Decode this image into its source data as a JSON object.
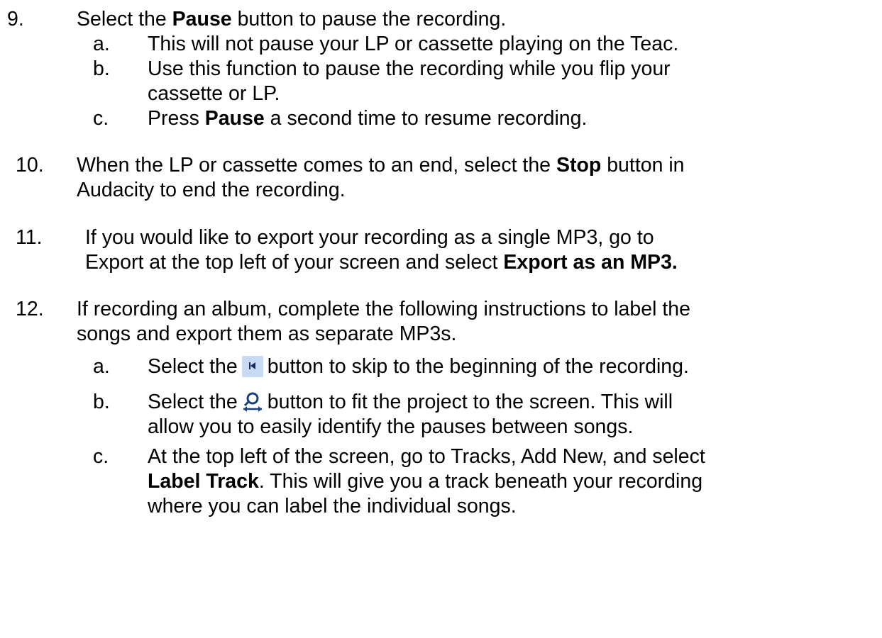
{
  "steps": [
    {
      "number": "9.",
      "lines": [
        {
          "pre": "Select the ",
          "bold": "Pause",
          "post": " button to pause the recording."
        }
      ],
      "subs": [
        {
          "letter": "a.",
          "lines": [
            "This will not pause your LP or cassette playing on the Teac."
          ]
        },
        {
          "letter": "b.",
          "lines": [
            "Use this function to pause the recording while you flip your",
            "cassette or LP."
          ]
        },
        {
          "letter": "c.",
          "pre": "Press ",
          "bold": "Pause",
          "post": " a second time to resume recording."
        }
      ]
    },
    {
      "number": "10.",
      "line1_pre": "When the LP or cassette comes to an end, select the ",
      "line1_bold": "Stop",
      "line1_post": " button in",
      "line2": "Audacity to end the recording."
    },
    {
      "number": "11.",
      "line1": "If you would like to export your recording as a single MP3, go to",
      "line2_pre": "Export at the top left of your screen and select ",
      "line2_bold": "Export as an MP3."
    },
    {
      "number": "12.",
      "line1": "If recording an album, complete the following instructions to label the",
      "line2": "songs and export them as separate MP3s.",
      "subs": [
        {
          "letter": "a.",
          "pre": "Select the",
          "icon": "skip-to-start-icon",
          "post": "button to skip to the beginning of the recording."
        },
        {
          "letter": "b.",
          "pre": "Select the",
          "icon": "fit-project-icon",
          "post": "button to fit the project to the screen. This will",
          "line2": "allow you to easily identify the pauses between songs."
        },
        {
          "letter": "c.",
          "line1": "At the top left of the screen, go to Tracks, Add New, and select",
          "line2_bold": "Label Track",
          "line2_post": ". This will give you a track beneath your recording",
          "line3": "where you can label the individual songs."
        }
      ]
    }
  ]
}
